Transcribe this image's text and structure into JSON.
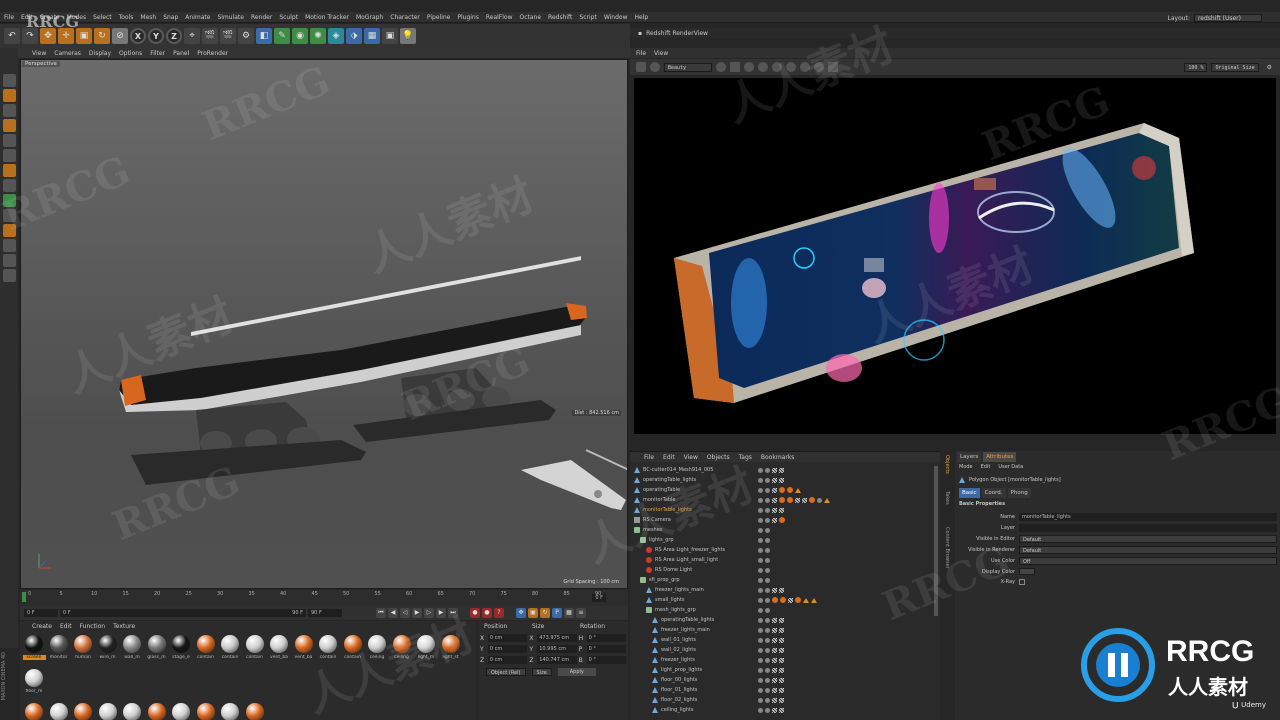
{
  "watermark": {
    "latin": "RRCG",
    "cjk": "人人素材"
  },
  "menu": [
    "File",
    "Edit",
    "Create",
    "Modes",
    "Select",
    "Tools",
    "Mesh",
    "Snap",
    "Animate",
    "Simulate",
    "Render",
    "Sculpt",
    "Motion Tracker",
    "MoGraph",
    "Character",
    "Pipeline",
    "Plugins",
    "RealFlow",
    "Octane",
    "Redshift",
    "Script",
    "Window",
    "Help"
  ],
  "layout": {
    "label": "Layout:",
    "value": "redshift (User)"
  },
  "viewport": {
    "menu": [
      "View",
      "Cameras",
      "Display",
      "Options",
      "Filter",
      "Panel",
      "ProRender"
    ],
    "name": "Perspective",
    "distance": "Dist : 842.516 cm",
    "grid": "Grid Spacing : 100 cm"
  },
  "timeline": {
    "ticks": [
      "0",
      "5",
      "10",
      "15",
      "20",
      "25",
      "30",
      "35",
      "40",
      "45",
      "50",
      "55",
      "60",
      "65",
      "70",
      "75",
      "80",
      "85",
      "90"
    ],
    "end_frame": "0 F",
    "start_field": "0 F",
    "cur_field": "0 F",
    "max_field": "90 F",
    "max2_field": "90 F"
  },
  "materials": {
    "menu": [
      "Create",
      "Edit",
      "Function",
      "Texture"
    ],
    "row1": [
      {
        "label": "screen",
        "color": "#111111",
        "selected": true
      },
      {
        "label": "monitor",
        "color": "#555555"
      },
      {
        "label": "human",
        "color": "#d07038"
      },
      {
        "label": "wire_m",
        "color": "#222222"
      },
      {
        "label": "wall_m",
        "color": "#888888"
      },
      {
        "label": "glass_m",
        "color": "#777777"
      },
      {
        "label": "stage_e",
        "color": "#151515"
      },
      {
        "label": "contain",
        "color": "#d8661f"
      },
      {
        "label": "contain",
        "color": "#c9c9c9"
      },
      {
        "label": "contain",
        "color": "#d0d0d0"
      },
      {
        "label": "vent_ba",
        "color": "#cfcfcf"
      },
      {
        "label": "vent_ba",
        "color": "#d8661f"
      },
      {
        "label": "contain",
        "color": "#cccccc"
      },
      {
        "label": "contain",
        "color": "#d8661f"
      },
      {
        "label": "ceiling",
        "color": "#cfcfcf"
      },
      {
        "label": "ceiling",
        "color": "#d8661f"
      },
      {
        "label": "light_m",
        "color": "#d4d4d4"
      },
      {
        "label": "light_st",
        "color": "#d8661f"
      },
      {
        "label": "floor_m",
        "color": "#d0d0d0"
      }
    ],
    "row2": [
      {
        "label": "floor_st",
        "color": "#d8661f"
      },
      {
        "label": "freezer",
        "color": "#d0d0d0"
      },
      {
        "label": "freezer",
        "color": "#d8661f"
      },
      {
        "label": "stair_m",
        "color": "#d0d0d0"
      },
      {
        "label": "wall_m",
        "color": "#d0d0d0"
      },
      {
        "label": "wall_st",
        "color": "#d8661f"
      },
      {
        "label": "ducts_n",
        "color": "#d0d0d0"
      },
      {
        "label": "ducts_s",
        "color": "#d8661f"
      },
      {
        "label": "operatio",
        "color": "#cfcfcf"
      },
      {
        "label": "operati",
        "color": "#d8661f"
      }
    ]
  },
  "coords": {
    "headers": [
      "Position",
      "Size",
      "Rotation"
    ],
    "rows": [
      {
        "axis": "X",
        "pos": "0 cm",
        "size": "473.975 cm",
        "rot_axis": "H",
        "rot": "0 °"
      },
      {
        "axis": "Y",
        "pos": "0 cm",
        "size": "10.995 cm",
        "rot_axis": "P",
        "rot": "0 °"
      },
      {
        "axis": "Z",
        "pos": "0 cm",
        "size": "140.747 cm",
        "rot_axis": "B",
        "rot": "0 °"
      }
    ],
    "mode": "Object (Rel)",
    "size_mode": "Size",
    "apply": "Apply"
  },
  "renderview": {
    "title": "Redshift RenderView",
    "menu": [
      "File",
      "View"
    ],
    "aov": "Beauty",
    "zoom": "100 %",
    "size": "Original Size"
  },
  "objects": {
    "menu": [
      "File",
      "Edit",
      "View",
      "Objects",
      "Tags",
      "Bookmarks"
    ],
    "items": [
      {
        "name": "BC-cutter014_Mesh914_005",
        "indent": 0,
        "icon": "tri",
        "tags": "ck"
      },
      {
        "name": "operatingTable_lights",
        "indent": 0,
        "icon": "tri",
        "tags": "ck"
      },
      {
        "name": "operatingTable",
        "indent": 0,
        "icon": "tri",
        "tags": "mats1"
      },
      {
        "name": "monitorTable",
        "indent": 0,
        "icon": "tri",
        "tags": "mats2"
      },
      {
        "name": "monitorTable_lights",
        "indent": 0,
        "icon": "tri",
        "tags": "ck",
        "selected": true
      },
      {
        "name": "RS Camera",
        "indent": 0,
        "icon": "cam",
        "tags": "cam"
      },
      {
        "name": "meshes",
        "indent": 0,
        "icon": "l0",
        "tags": ""
      },
      {
        "name": "lights_grp",
        "indent": 1,
        "icon": "l0",
        "tags": ""
      },
      {
        "name": "RS Area Light_freezer_lights",
        "indent": 2,
        "icon": "lt",
        "tags": ""
      },
      {
        "name": "RS Area Light_small_light",
        "indent": 2,
        "icon": "lt",
        "tags": ""
      },
      {
        "name": "RS Dome Light",
        "indent": 2,
        "icon": "lt",
        "tags": ""
      },
      {
        "name": "sfi_prop_grp",
        "indent": 1,
        "icon": "l0",
        "tags": ""
      },
      {
        "name": "freezer_lights_main",
        "indent": 2,
        "icon": "tri",
        "tags": "ck"
      },
      {
        "name": "small_lights",
        "indent": 2,
        "icon": "tri",
        "tags": "mats3"
      },
      {
        "name": "mesh_lights_grp",
        "indent": 2,
        "icon": "l0",
        "tags": ""
      },
      {
        "name": "operatingTable_lights",
        "indent": 3,
        "icon": "tri",
        "tags": "ck"
      },
      {
        "name": "freezer_lights_main",
        "indent": 3,
        "icon": "tri",
        "tags": "ck"
      },
      {
        "name": "wall_01_lights",
        "indent": 3,
        "icon": "tri",
        "tags": "ck"
      },
      {
        "name": "wall_02_lights",
        "indent": 3,
        "icon": "tri",
        "tags": "ck"
      },
      {
        "name": "freezer_lights",
        "indent": 3,
        "icon": "tri",
        "tags": "ck"
      },
      {
        "name": "light_prop_lights",
        "indent": 3,
        "icon": "tri",
        "tags": "ck"
      },
      {
        "name": "floor_00_lights",
        "indent": 3,
        "icon": "tri",
        "tags": "ck"
      },
      {
        "name": "floor_01_lights",
        "indent": 3,
        "icon": "tri",
        "tags": "ck"
      },
      {
        "name": "floor_02_lights",
        "indent": 3,
        "icon": "tri",
        "tags": "ck"
      },
      {
        "name": "ceiling_lights",
        "indent": 3,
        "icon": "tri",
        "tags": "ck"
      }
    ]
  },
  "attributes": {
    "tabs": [
      "Layers",
      "Attributes"
    ],
    "menu": [
      "Mode",
      "Edit",
      "User Data"
    ],
    "object_title": "Polygon Object [monitorTable_lights]",
    "subtabs": [
      "Basic",
      "Coord.",
      "Phong"
    ],
    "section": "Basic Properties",
    "fields": [
      {
        "label": "Name",
        "value": "monitorTable_lights",
        "kind": "text"
      },
      {
        "label": "Layer",
        "value": "",
        "kind": "text"
      },
      {
        "label": "Visible in Editor",
        "value": "Default",
        "kind": "select"
      },
      {
        "label": "Visible in Renderer",
        "value": "Default",
        "kind": "select"
      },
      {
        "label": "Use Color",
        "value": "Off",
        "kind": "select"
      },
      {
        "label": "Display Color",
        "value": "",
        "kind": "color"
      },
      {
        "label": "X-Ray",
        "value": "",
        "kind": "check"
      }
    ]
  },
  "side_tabs": [
    "Objects",
    "Takes",
    "Content Browser"
  ],
  "brand": {
    "name": "RRCG",
    "sub": "人人素材",
    "udemy": "Udemy",
    "maxon": "MAXON CINEMA 4D"
  }
}
